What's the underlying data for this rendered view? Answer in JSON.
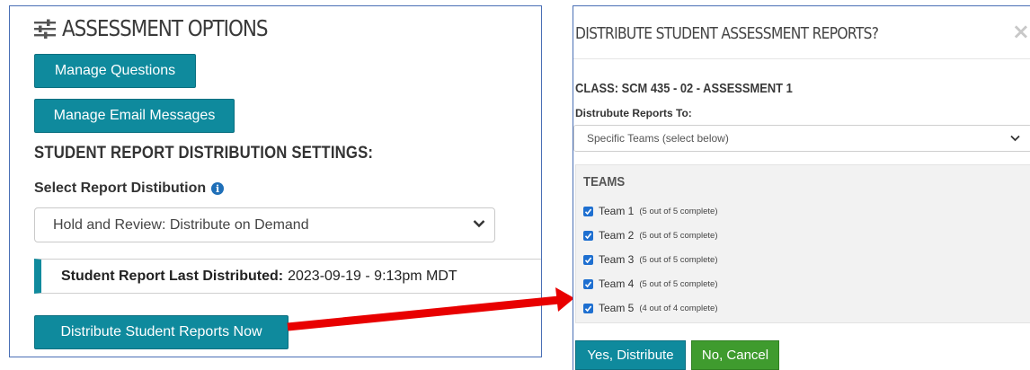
{
  "assessment_options": {
    "title": "ASSESSMENT OPTIONS",
    "manage_questions_label": "Manage Questions",
    "manage_email_label": "Manage Email Messages",
    "settings_heading": "STUDENT REPORT DISTRIBUTION SETTINGS:",
    "select_label": "Select Report Distibution",
    "select_value": "Hold and Review: Distribute on Demand",
    "last_distributed_label": "Student Report Last Distributed:",
    "last_distributed_value": "2023-09-19 - 9:13pm MDT",
    "distribute_now_label": "Distribute Student Reports Now"
  },
  "modal": {
    "title": "DISTRIBUTE STUDENT ASSESSMENT REPORTS?",
    "close_symbol": "×",
    "class_line": "CLASS: SCM 435 - 02 - ASSESSMENT 1",
    "distribute_to_label": "Distrubute Reports To:",
    "distribute_to_value": "Specific Teams (select below)",
    "teams_heading": "TEAMS",
    "teams": [
      {
        "name": "Team 1",
        "status": "(5 out of 5 complete)",
        "checked": true
      },
      {
        "name": "Team 2",
        "status": "(5 out of 5 complete)",
        "checked": true
      },
      {
        "name": "Team 3",
        "status": "(5 out of 5 complete)",
        "checked": true
      },
      {
        "name": "Team 4",
        "status": "(5 out of 5 complete)",
        "checked": true
      },
      {
        "name": "Team 5",
        "status": "(4 out of 4 complete)",
        "checked": true
      }
    ],
    "yes_label": "Yes, Distribute",
    "no_label": "No, Cancel"
  },
  "colors": {
    "teal": "#0f8a9d",
    "green": "#3f9b2e",
    "arrow": "#e80000",
    "panel_border": "#4a6fb5"
  },
  "icons": {
    "options": "sliders-icon",
    "info": "info-icon",
    "dropdown": "chevron-down-icon",
    "close": "close-icon",
    "checkbox": "checkbox-checked-icon",
    "callout": "red-arrow"
  }
}
